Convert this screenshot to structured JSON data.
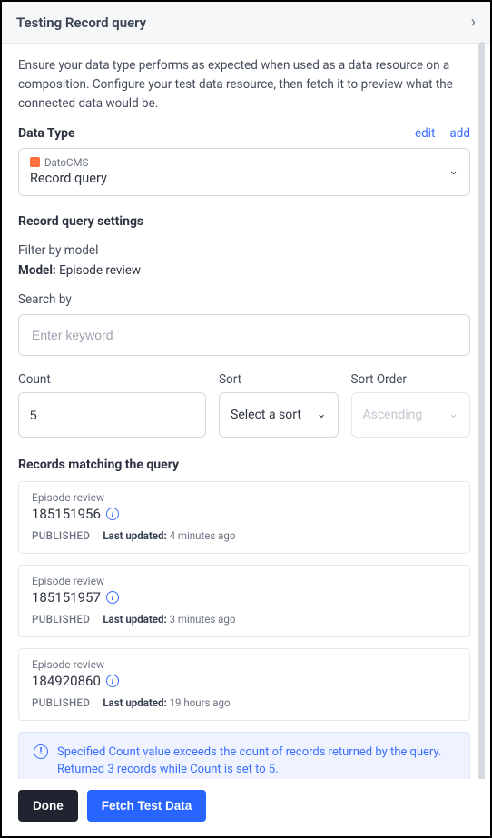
{
  "header": {
    "title": "Testing Record query"
  },
  "description": "Ensure your data type performs as expected when used as a data resource on a composition. Configure your test data resource, then fetch it to preview what the connected data would be.",
  "dataType": {
    "label": "Data Type",
    "editLabel": "edit",
    "addLabel": "add",
    "pluginName": "DatoCMS",
    "typeName": "Record query"
  },
  "settings": {
    "title": "Record query settings",
    "filterLabel": "Filter by model",
    "modelKey": "Model:",
    "modelValue": "Episode review",
    "searchLabel": "Search by",
    "searchPlaceholder": "Enter keyword",
    "count": {
      "label": "Count",
      "value": "5"
    },
    "sort": {
      "label": "Sort",
      "placeholder": "Select a sort"
    },
    "sortOrder": {
      "label": "Sort Order",
      "placeholder": "Ascending"
    }
  },
  "records": {
    "title": "Records matching the query",
    "items": [
      {
        "type": "Episode review",
        "id": "185151956",
        "status": "PUBLISHED",
        "updatedKey": "Last updated:",
        "updatedVal": "4 minutes ago"
      },
      {
        "type": "Episode review",
        "id": "185151957",
        "status": "PUBLISHED",
        "updatedKey": "Last updated:",
        "updatedVal": "3 minutes ago"
      },
      {
        "type": "Episode review",
        "id": "184920860",
        "status": "PUBLISHED",
        "updatedKey": "Last updated:",
        "updatedVal": "19 hours ago"
      }
    ]
  },
  "alert": "Specified Count value exceeds the count of records returned by the query. Returned 3 records while Count is set to 5.",
  "footer": {
    "done": "Done",
    "fetch": "Fetch Test Data"
  }
}
